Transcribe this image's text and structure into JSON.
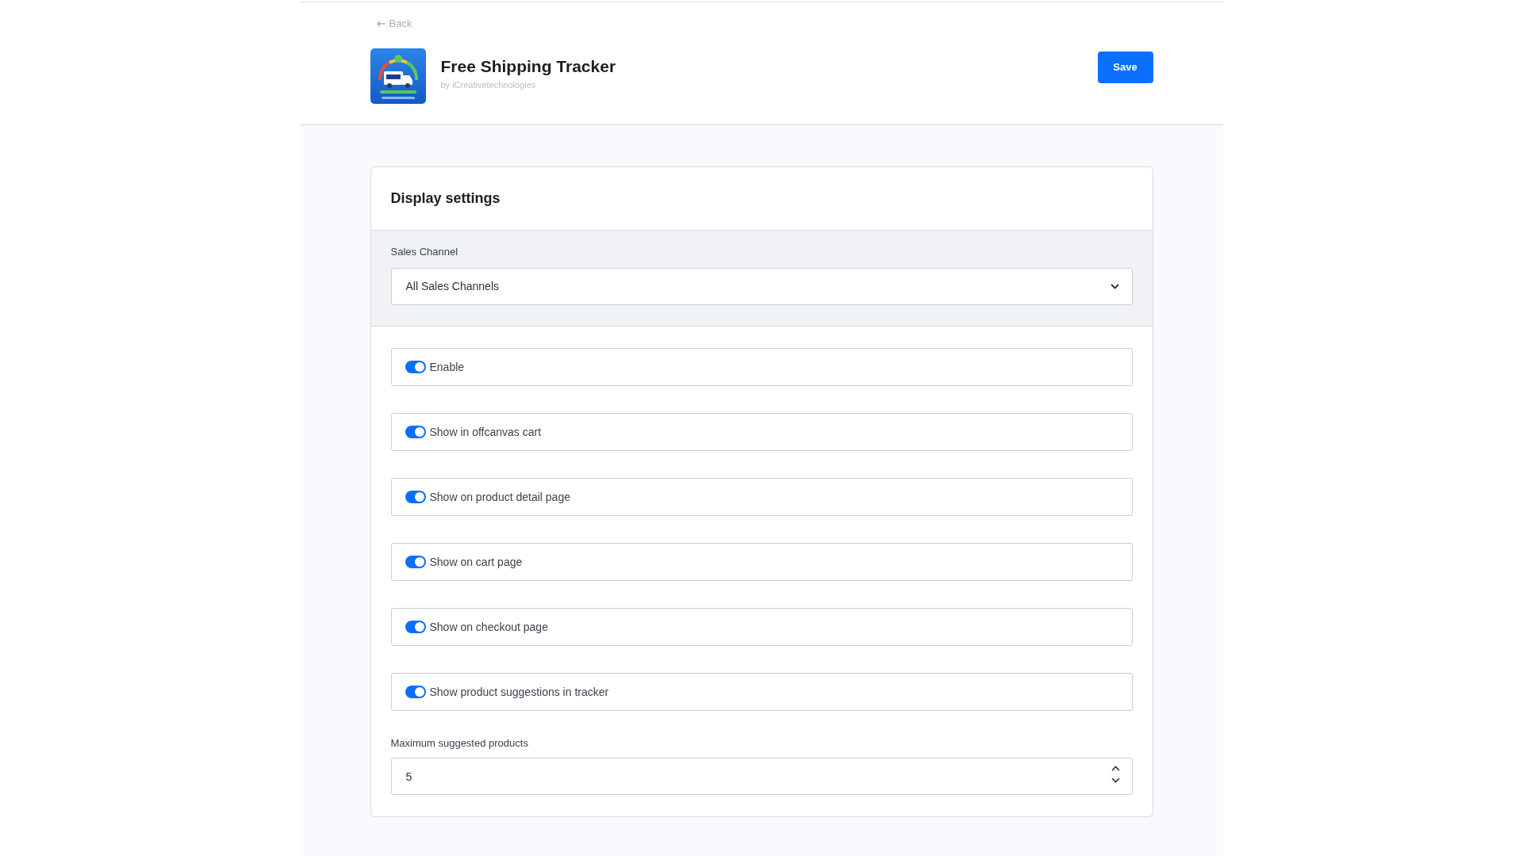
{
  "header": {
    "back_link": "Back",
    "app_name": "Free Shipping Tracker",
    "vendor": "by iCreativetechnologies",
    "save_button": "Save"
  },
  "card": {
    "title": "Display settings",
    "sales_channel": {
      "label": "Sales Channel",
      "value": "All Sales Channels"
    },
    "toggles": [
      {
        "label": "Enable",
        "on": true
      },
      {
        "label": "Show in offcanvas cart",
        "on": true
      },
      {
        "label": "Show on product detail page",
        "on": true
      },
      {
        "label": "Show on cart page",
        "on": true
      },
      {
        "label": "Show on checkout page",
        "on": true
      },
      {
        "label": "Show product suggestions in tracker",
        "on": true
      }
    ],
    "max_suggested": {
      "label": "Maximum suggested products",
      "value": "5"
    }
  }
}
